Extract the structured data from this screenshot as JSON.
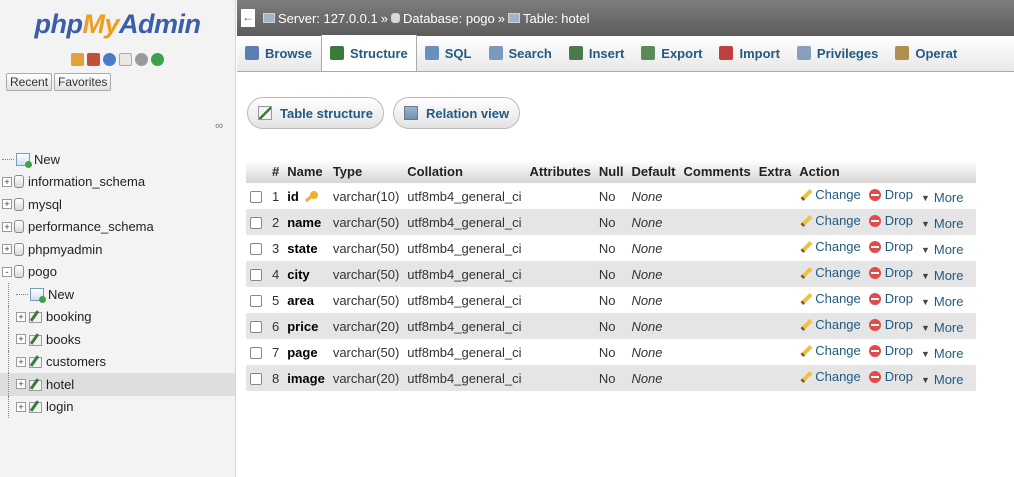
{
  "nav": {
    "logo": {
      "php": "php",
      "my": "My",
      "admin": "Admin"
    },
    "recent_label": "Recent",
    "favorites_label": "Favorites",
    "tree": [
      {
        "label": "New",
        "type": "new",
        "level": 0,
        "expander": ""
      },
      {
        "label": "information_schema",
        "type": "db",
        "level": 0,
        "expander": "+"
      },
      {
        "label": "mysql",
        "type": "db",
        "level": 0,
        "expander": "+"
      },
      {
        "label": "performance_schema",
        "type": "db",
        "level": 0,
        "expander": "+"
      },
      {
        "label": "phpmyadmin",
        "type": "db",
        "level": 0,
        "expander": "+"
      },
      {
        "label": "pogo",
        "type": "db",
        "level": 0,
        "expander": "-"
      },
      {
        "label": "New",
        "type": "new",
        "level": 1,
        "expander": ""
      },
      {
        "label": "booking",
        "type": "table",
        "level": 1,
        "expander": "+"
      },
      {
        "label": "books",
        "type": "table",
        "level": 1,
        "expander": "+"
      },
      {
        "label": "customers",
        "type": "table",
        "level": 1,
        "expander": "+"
      },
      {
        "label": "hotel",
        "type": "table",
        "level": 1,
        "expander": "+"
      },
      {
        "label": "login",
        "type": "table",
        "level": 1,
        "expander": "+"
      }
    ]
  },
  "breadcrumb": {
    "server": "Server: 127.0.0.1",
    "database": "Database: pogo",
    "table": "Table: hotel",
    "separator": "»"
  },
  "menu_tabs": [
    {
      "label": "Browse",
      "icon": "browse-icon",
      "color": "#5b7fb0"
    },
    {
      "label": "Structure",
      "icon": "structure-icon",
      "color": "#3a7a3a"
    },
    {
      "label": "SQL",
      "icon": "sql-icon",
      "color": "#6b8fb8"
    },
    {
      "label": "Search",
      "icon": "search-icon",
      "color": "#7a9ac0"
    },
    {
      "label": "Insert",
      "icon": "insert-icon",
      "color": "#4a7a4a"
    },
    {
      "label": "Export",
      "icon": "export-icon",
      "color": "#5a8a5a"
    },
    {
      "label": "Import",
      "icon": "import-icon",
      "color": "#c04040"
    },
    {
      "label": "Privileges",
      "icon": "privileges-icon",
      "color": "#8aa0b8"
    },
    {
      "label": "Operat",
      "icon": "operations-icon",
      "color": "#b09050"
    }
  ],
  "sub_buttons": {
    "table_structure": "Table structure",
    "relation_view": "Relation view"
  },
  "table": {
    "headers": [
      "#",
      "Name",
      "Type",
      "Collation",
      "Attributes",
      "Null",
      "Default",
      "Comments",
      "Extra",
      "Action"
    ],
    "rows": [
      {
        "num": "1",
        "name": "id",
        "type": "varchar(10)",
        "collation": "utf8mb4_general_ci",
        "attributes": "",
        "null": "No",
        "default": "None",
        "comments": "",
        "extra": "",
        "primary": true
      },
      {
        "num": "2",
        "name": "name",
        "type": "varchar(50)",
        "collation": "utf8mb4_general_ci",
        "attributes": "",
        "null": "No",
        "default": "None",
        "comments": "",
        "extra": "",
        "primary": false
      },
      {
        "num": "3",
        "name": "state",
        "type": "varchar(50)",
        "collation": "utf8mb4_general_ci",
        "attributes": "",
        "null": "No",
        "default": "None",
        "comments": "",
        "extra": "",
        "primary": false
      },
      {
        "num": "4",
        "name": "city",
        "type": "varchar(50)",
        "collation": "utf8mb4_general_ci",
        "attributes": "",
        "null": "No",
        "default": "None",
        "comments": "",
        "extra": "",
        "primary": false
      },
      {
        "num": "5",
        "name": "area",
        "type": "varchar(50)",
        "collation": "utf8mb4_general_ci",
        "attributes": "",
        "null": "No",
        "default": "None",
        "comments": "",
        "extra": "",
        "primary": false
      },
      {
        "num": "6",
        "name": "price",
        "type": "varchar(20)",
        "collation": "utf8mb4_general_ci",
        "attributes": "",
        "null": "No",
        "default": "None",
        "comments": "",
        "extra": "",
        "primary": false
      },
      {
        "num": "7",
        "name": "page",
        "type": "varchar(50)",
        "collation": "utf8mb4_general_ci",
        "attributes": "",
        "null": "No",
        "default": "None",
        "comments": "",
        "extra": "",
        "primary": false
      },
      {
        "num": "8",
        "name": "image",
        "type": "varchar(20)",
        "collation": "utf8mb4_general_ci",
        "attributes": "",
        "null": "No",
        "default": "None",
        "comments": "",
        "extra": "",
        "primary": false
      }
    ],
    "actions": {
      "change": "Change",
      "drop": "Drop",
      "more": "More"
    }
  }
}
